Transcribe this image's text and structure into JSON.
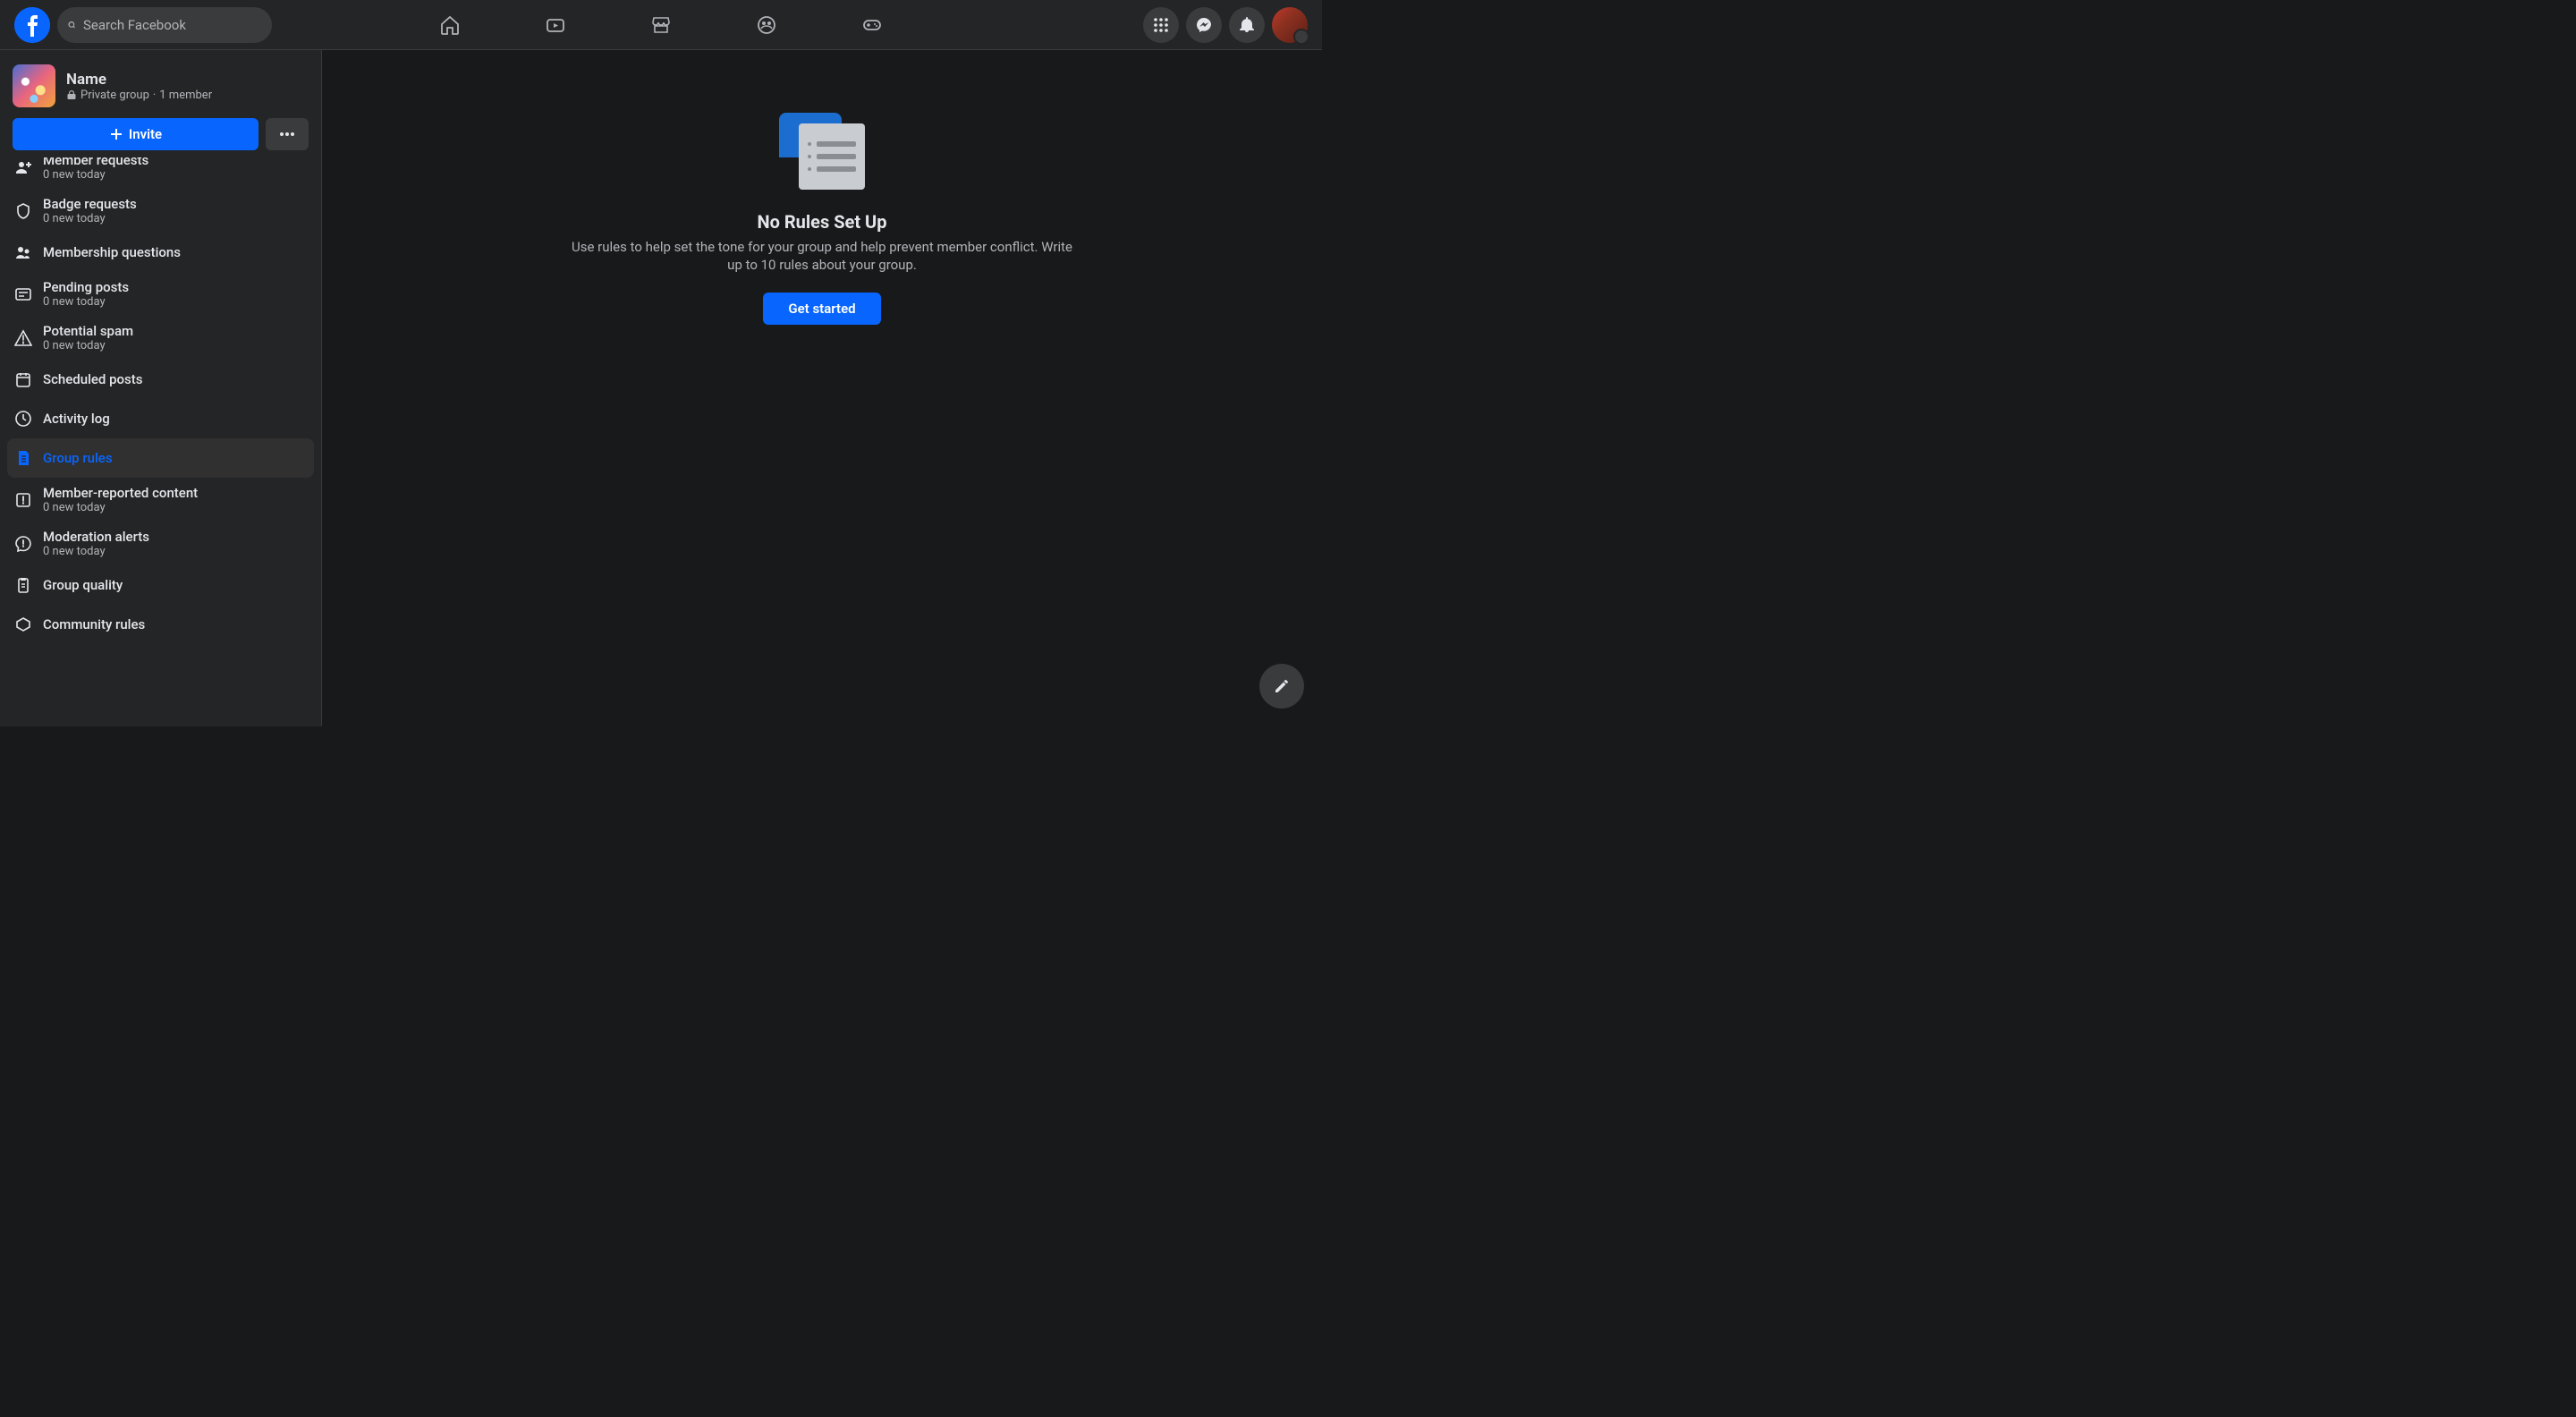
{
  "header": {
    "searchPlaceholder": "Search Facebook"
  },
  "group": {
    "name": "Name",
    "privacy": "Private group",
    "members": "1 member",
    "inviteLabel": "Invite"
  },
  "sidebar": {
    "items": [
      {
        "label": "Member requests",
        "sub": "0 new today",
        "icon": "person-add-icon"
      },
      {
        "label": "Badge requests",
        "sub": "0 new today",
        "icon": "badge-icon"
      },
      {
        "label": "Membership questions",
        "sub": "",
        "icon": "question-icon"
      },
      {
        "label": "Pending posts",
        "sub": "0 new today",
        "icon": "post-icon"
      },
      {
        "label": "Potential spam",
        "sub": "0 new today",
        "icon": "warning-icon"
      },
      {
        "label": "Scheduled posts",
        "sub": "",
        "icon": "calendar-icon"
      },
      {
        "label": "Activity log",
        "sub": "",
        "icon": "clock-icon"
      },
      {
        "label": "Group rules",
        "sub": "",
        "icon": "rules-icon",
        "active": true
      },
      {
        "label": "Member-reported content",
        "sub": "0 new today",
        "icon": "flag-icon"
      },
      {
        "label": "Moderation alerts",
        "sub": "0 new today",
        "icon": "alert-icon"
      },
      {
        "label": "Group quality",
        "sub": "",
        "icon": "clipboard-icon"
      },
      {
        "label": "Community rules",
        "sub": "",
        "icon": "community-icon"
      }
    ]
  },
  "main": {
    "title": "No Rules Set Up",
    "description": "Use rules to help set the tone for your group and help prevent member conflict. Write up to 10 rules about your group.",
    "cta": "Get started"
  }
}
